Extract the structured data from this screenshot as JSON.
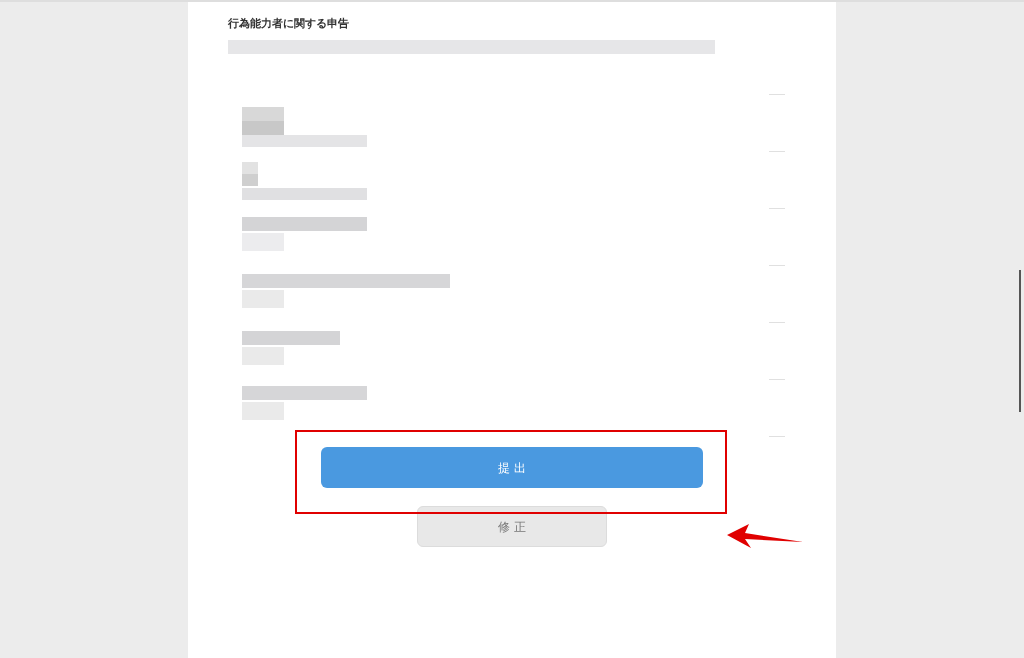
{
  "form": {
    "title": "行為能力者に関する申告"
  },
  "buttons": [
    {
      "kind": "primary",
      "label": "提 出"
    },
    {
      "kind": "secondary",
      "label": "修 正"
    }
  ]
}
